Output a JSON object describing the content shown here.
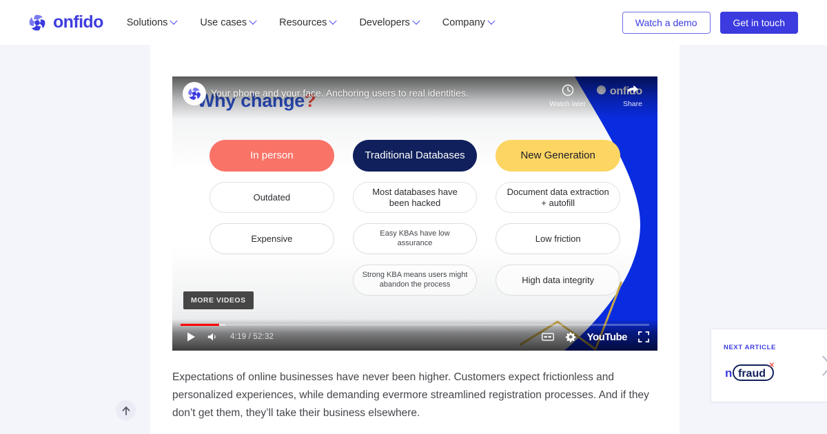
{
  "brand": {
    "logo_text": "onfido",
    "accent": "#3b3be0",
    "logo_icon": "onfido-mark-icon"
  },
  "header": {
    "nav": [
      {
        "label": "Solutions",
        "icon": "chevron-down-icon"
      },
      {
        "label": "Use cases",
        "icon": "chevron-down-icon"
      },
      {
        "label": "Resources",
        "icon": "chevron-down-icon"
      },
      {
        "label": "Developers",
        "icon": "chevron-down-icon"
      },
      {
        "label": "Company",
        "icon": "chevron-down-icon"
      }
    ],
    "demo_button": "Watch a demo",
    "contact_button": "Get in touch"
  },
  "video": {
    "channel_avatar": "onfido-avatar-icon",
    "title": "Your phone and your face. Anchoring users to real identities.",
    "watch_later_label": "Watch later",
    "watch_later_icon": "clock-icon",
    "share_label": "Share",
    "share_icon": "share-arrow-icon",
    "more_videos_label": "MORE VIDEOS",
    "current_time": "4:19",
    "duration": "52:32",
    "time_display": "4:19 / 52:32",
    "play_icon": "play-icon",
    "volume_icon": "volume-icon",
    "captions_icon": "closed-captions-icon",
    "settings_icon": "gear-icon",
    "fullscreen_icon": "fullscreen-icon",
    "brand_label": "YouTube",
    "progress_percent": 8.2,
    "buffered_percent": 9.5
  },
  "slide": {
    "title_main": "Why change",
    "title_mark": "?",
    "logo_text": "onfido",
    "title_color": "#2b4fc4",
    "mark_color": "#e0453c",
    "wedge_color": "#0a2ce0",
    "columns": [
      {
        "heading": "In person",
        "heading_style": "coral",
        "heading_bg": "#f97367",
        "items": [
          "Outdated",
          "Expensive"
        ]
      },
      {
        "heading": "Traditional Databases",
        "heading_style": "navy",
        "heading_bg": "#10205c",
        "items": [
          "Most databases have been hacked",
          "Easy KBAs have low assurance",
          "Strong KBA means users might abandon the process"
        ]
      },
      {
        "heading": "New Generation",
        "heading_style": "gold",
        "heading_bg": "#fcd563",
        "items": [
          "Document data extraction + autofill",
          "Low friction",
          "High data integrity"
        ]
      }
    ]
  },
  "article": {
    "paragraph": "Expectations of online businesses have never been higher. Customers expect frictionless and personalized experiences, while demanding evermore streamlined registration processes. And if they don’t get them, they’ll take their business elsewhere."
  },
  "next_article": {
    "label": "NEXT ARTICLE",
    "thumb_text": "fraud",
    "thumb_mark": "×",
    "thumb_prefix": "n",
    "chevron_icon": "chevron-right-icon"
  },
  "scroll_top": {
    "icon": "arrow-up-icon"
  }
}
